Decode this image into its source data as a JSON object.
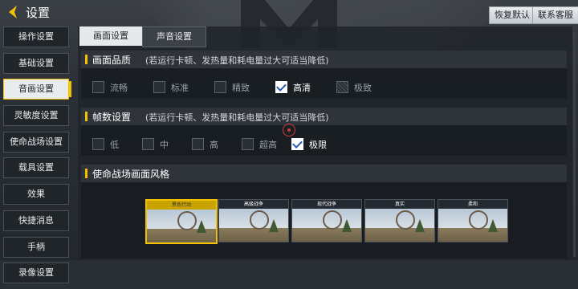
{
  "header": {
    "title": "设置",
    "restore_label": "恢复默认",
    "support_label": "联系客服"
  },
  "sidebar": {
    "items": [
      {
        "label": "操作设置"
      },
      {
        "label": "基础设置"
      },
      {
        "label": "音画设置",
        "active": true
      },
      {
        "label": "灵敏度设置"
      },
      {
        "label": "使命战场设置"
      },
      {
        "label": "载具设置"
      },
      {
        "label": "效果"
      },
      {
        "label": "快捷消息"
      },
      {
        "label": "手柄"
      },
      {
        "label": "录像设置"
      }
    ]
  },
  "tabs": [
    {
      "label": "画面设置",
      "active": true
    },
    {
      "label": "声音设置"
    }
  ],
  "quality": {
    "title": "画面品质",
    "note": "(若运行卡顿、发热量和耗电量过大可适当降低)",
    "options": [
      {
        "label": "流畅",
        "state": "off"
      },
      {
        "label": "标准",
        "state": "off"
      },
      {
        "label": "精致",
        "state": "off"
      },
      {
        "label": "高清",
        "state": "on"
      },
      {
        "label": "极致",
        "state": "disabled"
      }
    ]
  },
  "fps": {
    "title": "帧数设置",
    "note": "(若运行卡顿、发热量和耗电量过大可适当降低)",
    "options": [
      {
        "label": "低",
        "state": "off"
      },
      {
        "label": "中",
        "state": "off"
      },
      {
        "label": "高",
        "state": "off"
      },
      {
        "label": "超高",
        "state": "off"
      },
      {
        "label": "极限",
        "state": "on"
      }
    ]
  },
  "style": {
    "title": "使命战场画面风格",
    "cards": [
      {
        "label": "黑色行动",
        "selected": true
      },
      {
        "label": "高级战争"
      },
      {
        "label": "现代战争"
      },
      {
        "label": "真实"
      },
      {
        "label": "柔和"
      }
    ]
  },
  "colors": {
    "accent": "#f2c200",
    "check": "#2a5db0"
  }
}
